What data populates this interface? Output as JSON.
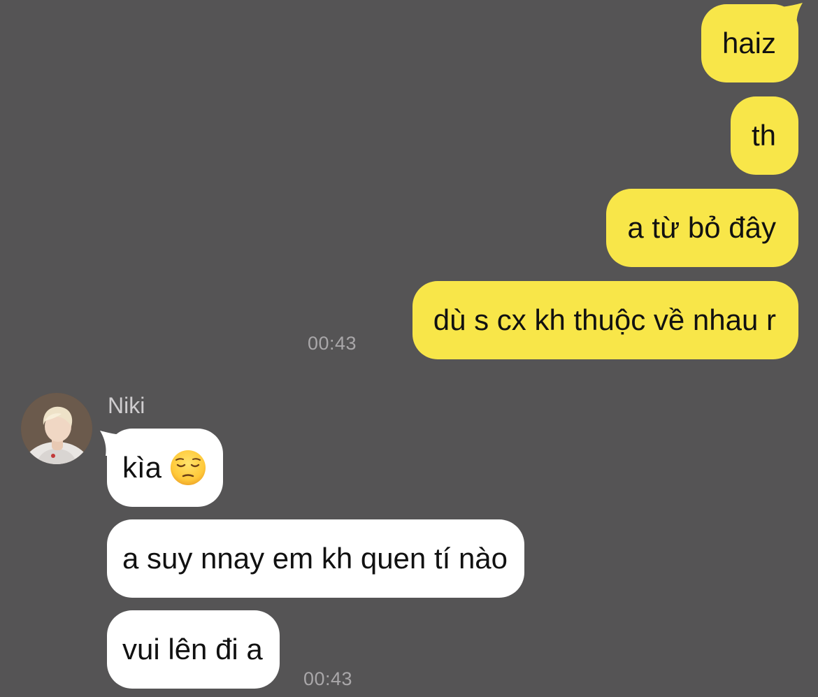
{
  "outgoing": [
    {
      "text": "haiz"
    },
    {
      "text": "th"
    },
    {
      "text": "a từ bỏ đây"
    },
    {
      "text": "dù s cx kh thuộc về nhau r"
    }
  ],
  "outgoing_time": "00:43",
  "incoming": {
    "sender": "Niki",
    "messages": [
      {
        "text": "kìa"
      },
      {
        "text": "a suy nnay em kh quen tí nào"
      },
      {
        "text": "vui lên đi a"
      }
    ],
    "time": "00:43",
    "emoji_icon": "pensive-face-emoji-icon"
  },
  "colors": {
    "background": "#555455",
    "outgoing_bubble": "#f8e649",
    "incoming_bubble": "#ffffff",
    "timestamp": "#a9a7a9"
  }
}
